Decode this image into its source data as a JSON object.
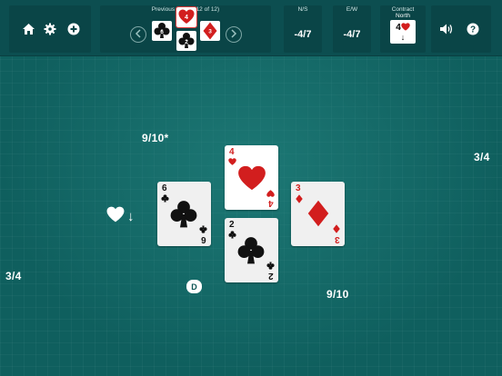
{
  "toolbar": {
    "icons": {
      "home": "home-icon",
      "settings": "gear-icon",
      "new_game": "plus-icon",
      "prev": "chevron-left-icon",
      "next": "chevron-right-icon",
      "sound": "speaker-icon",
      "help": "question-icon"
    },
    "previous_hands": {
      "label": "Previous hands (12 of 12)",
      "cards": [
        {
          "position": "north",
          "rank": "4",
          "suit": "hearts"
        },
        {
          "position": "west",
          "rank": "6",
          "suit": "clubs"
        },
        {
          "position": "east",
          "rank": "3",
          "suit": "diamonds"
        },
        {
          "position": "south",
          "rank": "2",
          "suit": "clubs"
        }
      ]
    },
    "ns": {
      "label": "N/S",
      "value": "-4/7"
    },
    "ew": {
      "label": "E/W",
      "value": "-4/7"
    },
    "contract": {
      "label": "Contract",
      "declarer": "North",
      "level": "4",
      "suit": "hearts",
      "modifier": "↓"
    }
  },
  "table": {
    "north_score": "9/10*",
    "east_score": "3/4",
    "west_score": "3/4",
    "south_score": "9/10",
    "bid_suit": "hearts",
    "bid_arrow": "↓",
    "dealer_label": "D"
  },
  "trick": {
    "north": {
      "rank": "4",
      "suit": "hearts"
    },
    "west": {
      "rank": "6",
      "suit": "clubs"
    },
    "east": {
      "rank": "3",
      "suit": "diamonds"
    },
    "south": {
      "rank": "2",
      "suit": "clubs"
    }
  },
  "colors": {
    "felt": "#0f5f5e",
    "toolbar": "#0c4e50",
    "red_suit": "#d21e1e",
    "black_suit": "#111111"
  }
}
